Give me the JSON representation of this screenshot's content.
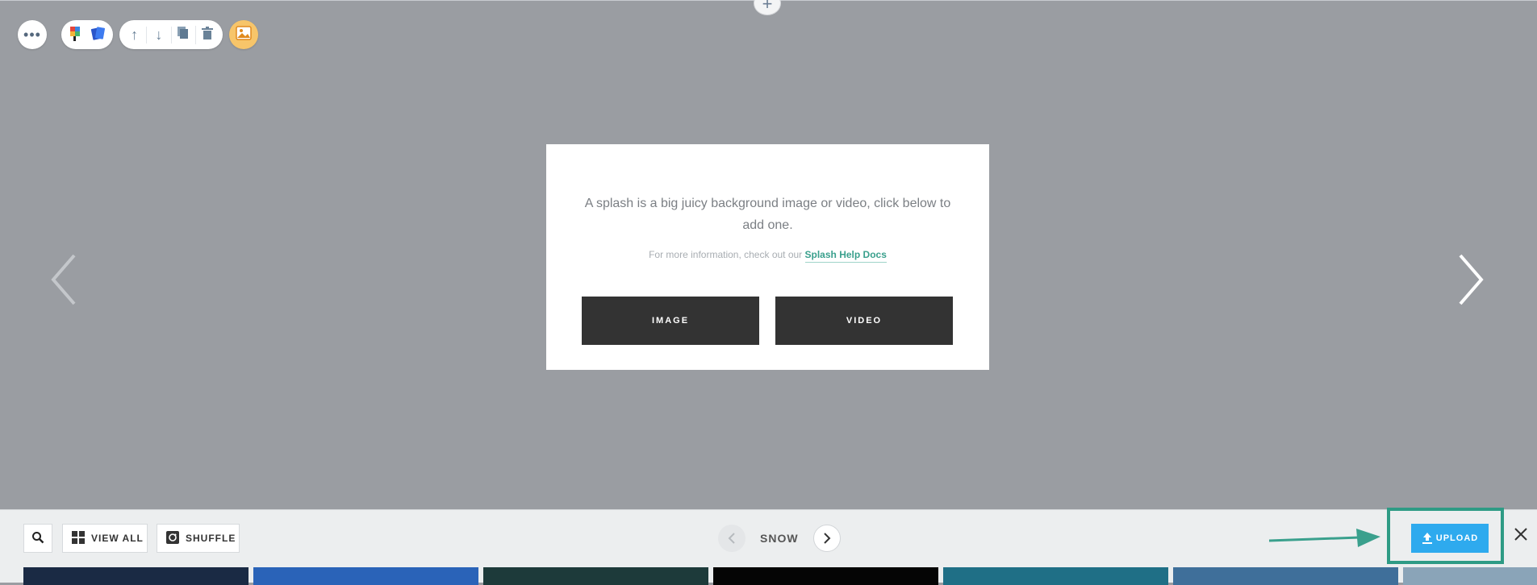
{
  "stage": {
    "add_section_glyph": "+",
    "toolbar": {
      "more_glyph": "•••",
      "move_up_glyph": "↑",
      "move_down_glyph": "↓"
    },
    "card": {
      "lead_text": "A splash is a big juicy background image or video, click below to add one.",
      "more_prefix": "For more information, check out our",
      "help_link": "Splash Help Docs",
      "image_button": "IMAGE",
      "video_button": "VIDEO"
    }
  },
  "browser": {
    "view_all_label": "VIEW ALL",
    "shuffle_label": "SHUFFLE",
    "category_name": "SNOW",
    "upload_label": "UPLOAD",
    "annotation_color": "#2e9b85",
    "upload_color": "#2eaaee",
    "thumbnails": [
      {
        "icon": "night-sky-thumb",
        "color": "#1a2a44"
      },
      {
        "icon": "clouds-thumb",
        "color": "#2a63b8"
      },
      {
        "icon": "aurora-thumb",
        "color": "#1d3a3a"
      },
      {
        "icon": "dark-thumb",
        "color": "#050505"
      },
      {
        "icon": "ice-thumb",
        "color": "#1f6f86"
      },
      {
        "icon": "frozen-thumb",
        "color": "#3f6f9a"
      },
      {
        "icon": "snow-thumb",
        "color": "#8aa4b8"
      }
    ]
  }
}
